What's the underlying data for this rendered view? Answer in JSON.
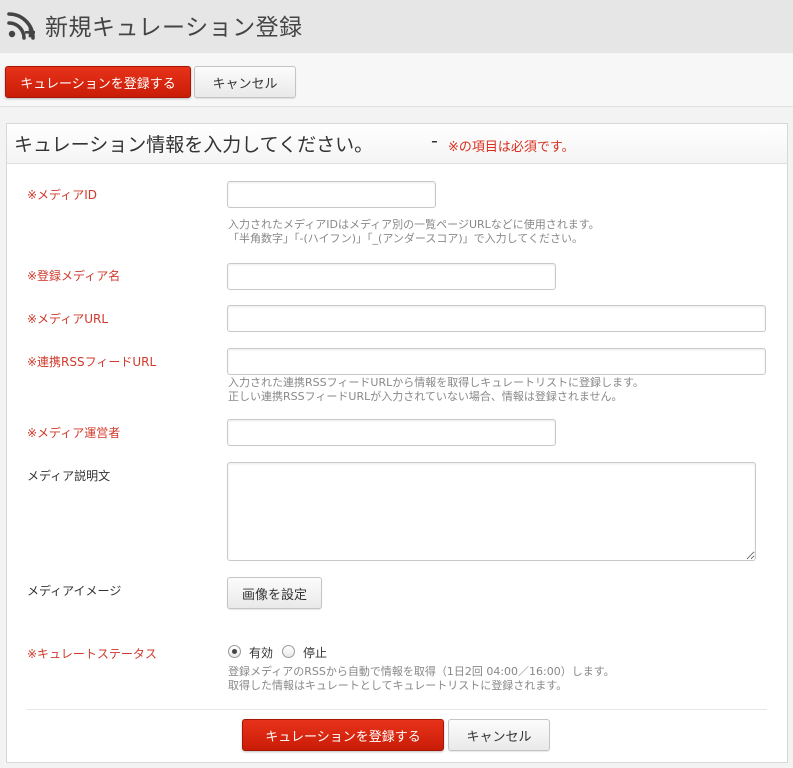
{
  "header": {
    "title": "新規キュレーション登録",
    "icon": "rss-add-icon"
  },
  "toolbar": {
    "register_label": "キュレーションを登録する",
    "cancel_label": "キャンセル"
  },
  "panel": {
    "title": "キュレーション情報を入力してください。",
    "dash": "-",
    "required_note": "※の項目は必須です。"
  },
  "form": {
    "media_id": {
      "label": "※メディアID",
      "value": "",
      "help1": "入力されたメディアIDはメディア別の一覧ページURLなどに使用されます。",
      "help2": "「半角数字」「-(ハイフン)」「_(アンダースコア)」で入力してください。"
    },
    "media_name": {
      "label": "※登録メディア名",
      "value": ""
    },
    "media_url": {
      "label": "※メディアURL",
      "value": ""
    },
    "rss_url": {
      "label": "※連携RSSフィードURL",
      "value": "",
      "help1": "入力された連携RSSフィードURLから情報を取得しキュレートリストに登録します。",
      "help2": "正しい連携RSSフィードURLが入力されていない場合、情報は登録されません。"
    },
    "operator": {
      "label": "※メディア運営者",
      "value": ""
    },
    "description": {
      "label": "メディア説明文",
      "value": ""
    },
    "image": {
      "label": "メディアイメージ",
      "button_label": "画像を設定"
    },
    "status": {
      "label": "※キュレートステータス",
      "options": [
        "有効",
        "停止"
      ],
      "selected": "有効",
      "help1": "登録メディアのRSSから自動で情報を取得（1日2回 04:00／16:00）します。",
      "help2": "取得した情報はキュレートとしてキュレートリストに登録されます。"
    }
  },
  "footer": {
    "register_label": "キュレーションを登録する",
    "cancel_label": "キャンセル"
  },
  "colors": {
    "accent": "#d9301e",
    "required": "#d0392b"
  }
}
